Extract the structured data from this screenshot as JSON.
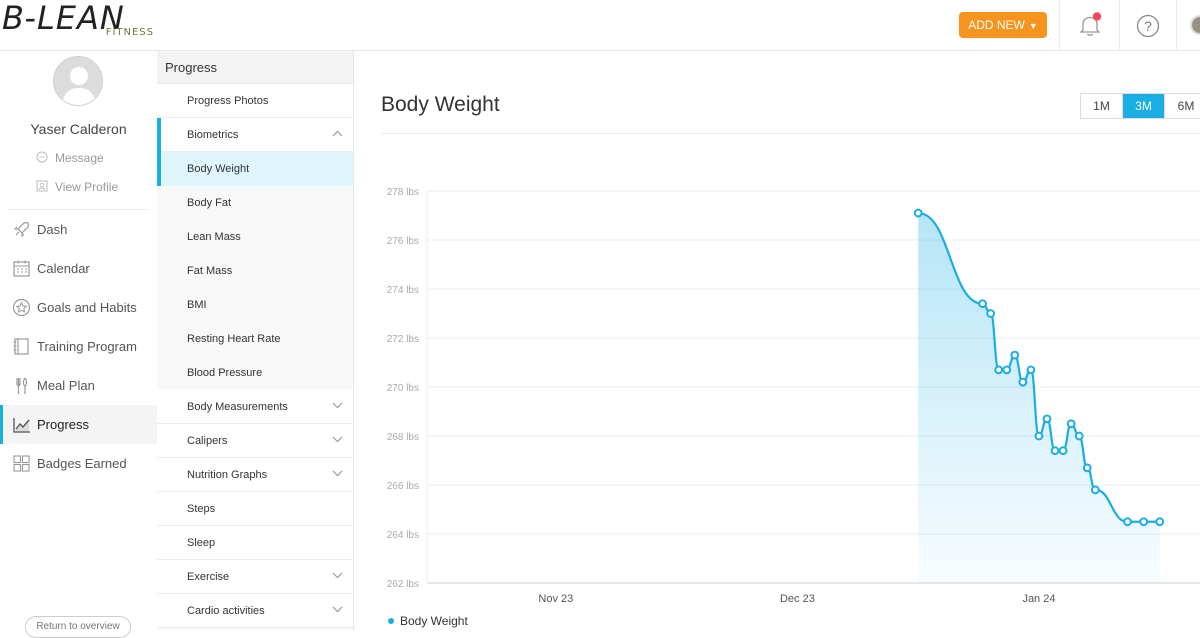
{
  "brand": {
    "logo_main": "B-LEAN",
    "logo_sub": "FITNESS"
  },
  "header": {
    "add_new": "ADD NEW",
    "add_new_caret": "▼",
    "help": "?"
  },
  "profile": {
    "name": "Yaser Calderon",
    "message": "Message",
    "view_profile": "View Profile"
  },
  "nav": [
    {
      "label": "Dash",
      "icon": "rocket-icon",
      "active": false
    },
    {
      "label": "Calendar",
      "icon": "calendar-icon",
      "active": false
    },
    {
      "label": "Goals and Habits",
      "icon": "star-badge-icon",
      "active": false
    },
    {
      "label": "Training Program",
      "icon": "notebook-icon",
      "active": false
    },
    {
      "label": "Meal Plan",
      "icon": "utensils-icon",
      "active": false
    },
    {
      "label": "Progress",
      "icon": "trend-chart-icon",
      "active": true
    },
    {
      "label": "Badges Earned",
      "icon": "grid-icon",
      "active": false
    }
  ],
  "return_label": "Return to overview",
  "subnav": {
    "header": "Progress",
    "items": [
      {
        "label": "Progress Photos",
        "chevron": "none",
        "child": false,
        "selected": false,
        "bar": false
      },
      {
        "label": "Biometrics",
        "chevron": "up",
        "child": false,
        "selected": false,
        "bar": true
      },
      {
        "label": "Body Weight",
        "chevron": "none",
        "child": true,
        "selected": true,
        "bar": true
      },
      {
        "label": "Body Fat",
        "chevron": "none",
        "child": true,
        "selected": false,
        "bar": false
      },
      {
        "label": "Lean Mass",
        "chevron": "none",
        "child": true,
        "selected": false,
        "bar": false
      },
      {
        "label": "Fat Mass",
        "chevron": "none",
        "child": true,
        "selected": false,
        "bar": false
      },
      {
        "label": "BMI",
        "chevron": "none",
        "child": true,
        "selected": false,
        "bar": false
      },
      {
        "label": "Resting Heart Rate",
        "chevron": "none",
        "child": true,
        "selected": false,
        "bar": false
      },
      {
        "label": "Blood Pressure",
        "chevron": "none",
        "child": true,
        "selected": false,
        "bar": false
      },
      {
        "label": "Body Measurements",
        "chevron": "down",
        "child": false,
        "selected": false,
        "bar": false
      },
      {
        "label": "Calipers",
        "chevron": "down",
        "child": false,
        "selected": false,
        "bar": false
      },
      {
        "label": "Nutrition Graphs",
        "chevron": "down",
        "child": false,
        "selected": false,
        "bar": false
      },
      {
        "label": "Steps",
        "chevron": "none",
        "child": false,
        "selected": false,
        "bar": false
      },
      {
        "label": "Sleep",
        "chevron": "none",
        "child": false,
        "selected": false,
        "bar": false
      },
      {
        "label": "Exercise",
        "chevron": "down",
        "child": false,
        "selected": false,
        "bar": false
      },
      {
        "label": "Cardio activities",
        "chevron": "down",
        "child": false,
        "selected": false,
        "bar": false
      }
    ]
  },
  "main": {
    "title": "Body Weight",
    "ranges": [
      {
        "label": "1M",
        "on": false
      },
      {
        "label": "3M",
        "on": true
      },
      {
        "label": "6M",
        "on": false
      }
    ]
  },
  "colors": {
    "accent": "#1aaee5",
    "orange": "#f7941d"
  },
  "chart_data": {
    "type": "area",
    "series": [
      {
        "name": "Body Weight",
        "x": [
          "2024-01-07",
          "2024-01-15",
          "2024-01-16",
          "2024-01-17",
          "2024-01-18",
          "2024-01-19",
          "2024-01-20",
          "2024-01-21",
          "2024-01-22",
          "2024-01-23",
          "2024-01-24",
          "2024-01-25",
          "2024-01-26",
          "2024-01-27",
          "2024-01-28",
          "2024-01-29",
          "2024-02-02",
          "2024-02-04",
          "2024-02-06"
        ],
        "values": [
          277.1,
          273.4,
          273.0,
          270.7,
          270.7,
          271.3,
          270.2,
          270.7,
          268.0,
          268.7,
          267.4,
          267.4,
          268.5,
          268.0,
          266.7,
          265.8,
          264.5,
          264.5,
          264.5
        ]
      }
    ],
    "ylim": [
      262,
      278
    ],
    "yticks": [
      "278 lbs",
      "276 lbs",
      "274 lbs",
      "272 lbs",
      "270 lbs",
      "268 lbs",
      "266 lbs",
      "264 lbs",
      "262 lbs"
    ],
    "ytick_values": [
      278,
      276,
      274,
      272,
      270,
      268,
      266,
      264,
      262
    ],
    "xticks": [
      {
        "label": "Nov 23",
        "date": "2023-11-23"
      },
      {
        "label": "Dec 23",
        "date": "2023-12-23"
      },
      {
        "label": "Jan 24",
        "date": "2024-01-22"
      }
    ],
    "xlim": [
      "2023-11-07",
      "2024-02-11"
    ],
    "grid": true,
    "legend": "bottom-left"
  }
}
